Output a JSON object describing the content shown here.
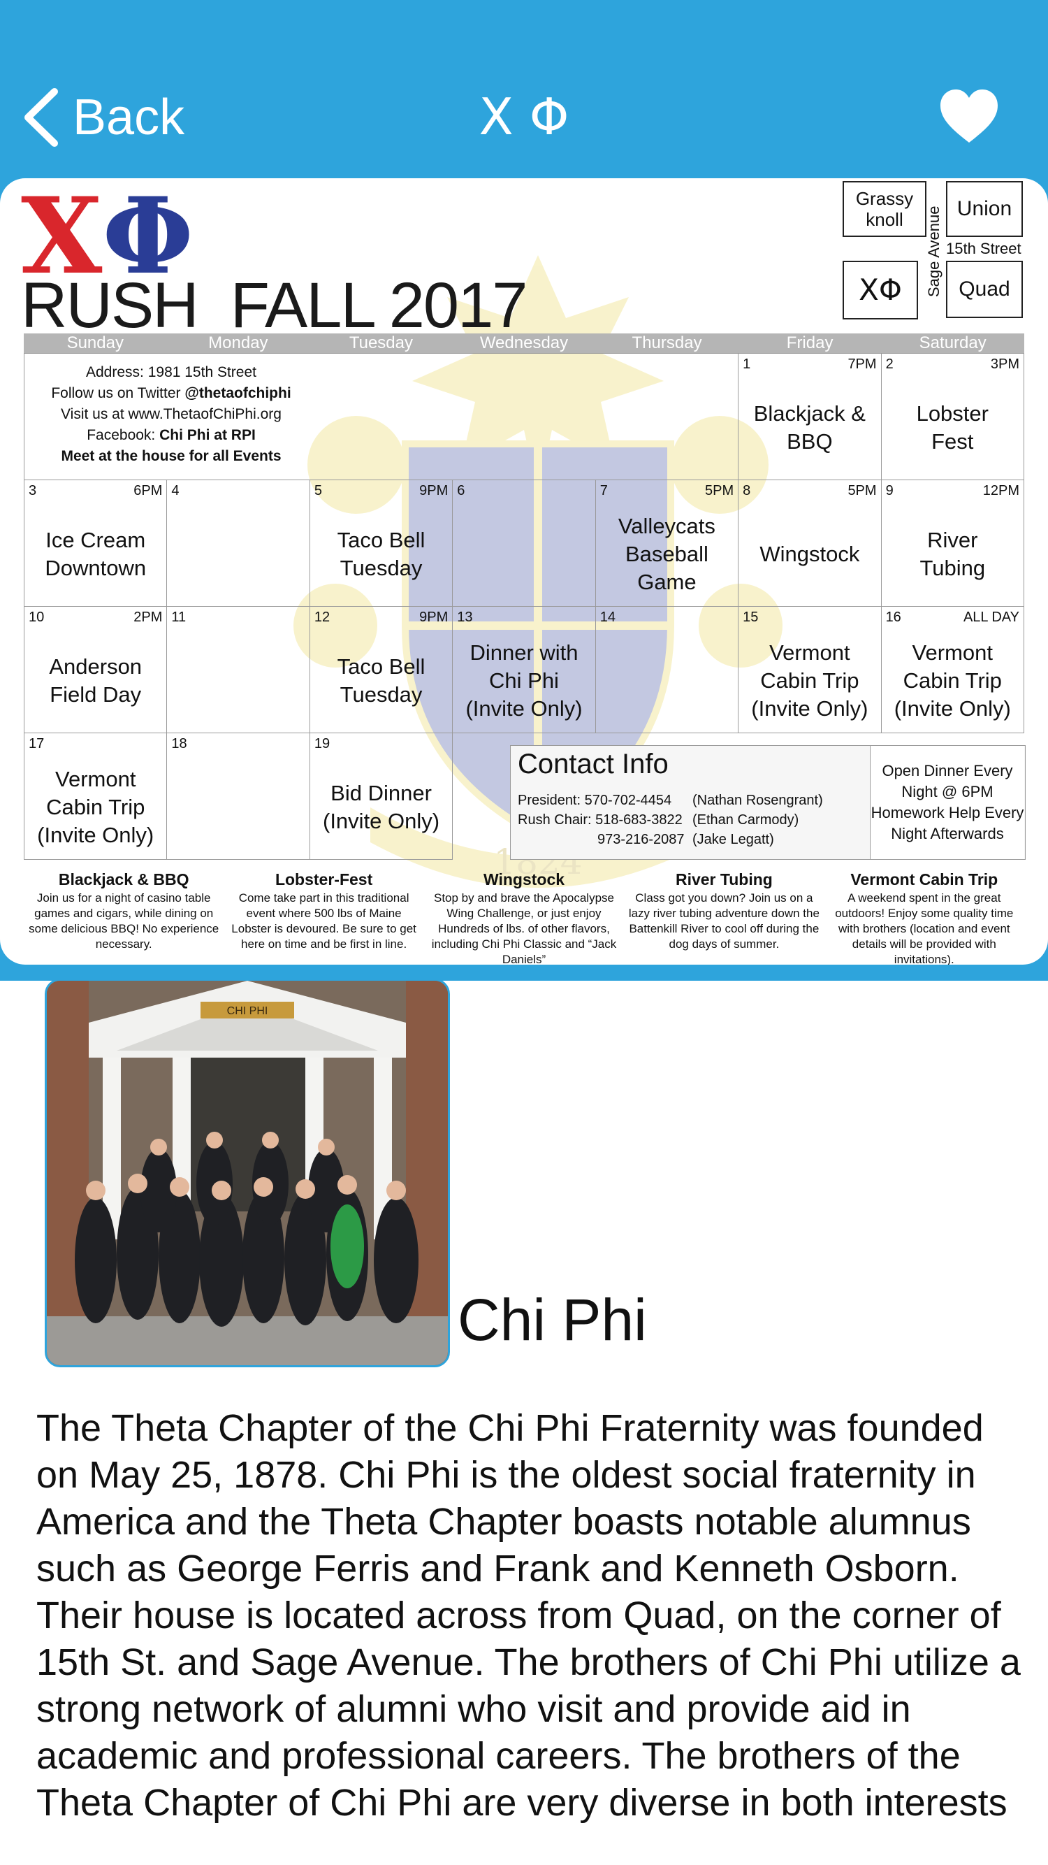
{
  "nav": {
    "back_label": "Back",
    "title": "Χ Φ"
  },
  "flyer": {
    "logo_chi": "Χ",
    "logo_phi": "Φ",
    "title": "RUSH  FALL 2017",
    "map": {
      "grassy_knoll": "Grassy knoll",
      "union": "Union",
      "street_15th": "15th Street",
      "sage_avenue": "Sage Avenue",
      "chi_phi": "ΧΦ",
      "quad": "Quad"
    },
    "days": [
      "Sunday",
      "Monday",
      "Tuesday",
      "Wednesday",
      "Thursday",
      "Friday",
      "Saturday"
    ],
    "info": {
      "address": "Address: 1981 15th Street",
      "twitter_prefix": "Follow us on Twitter ",
      "twitter": "@thetaofchiphi",
      "website": "Visit us at www.ThetaofChiPhi.org",
      "facebook_prefix": "Facebook: ",
      "facebook": "Chi Phi at RPI",
      "meet": "Meet at the house for all Events"
    },
    "cells": [
      {
        "day": "1",
        "time": "7PM",
        "event": "Blackjack &\nBBQ"
      },
      {
        "day": "2",
        "time": "3PM",
        "event": "Lobster\nFest"
      },
      {
        "day": "3",
        "time": "6PM",
        "event": "Ice Cream\nDowntown"
      },
      {
        "day": "4",
        "time": "",
        "event": ""
      },
      {
        "day": "5",
        "time": "9PM",
        "event": "Taco Bell\nTuesday"
      },
      {
        "day": "6",
        "time": "",
        "event": ""
      },
      {
        "day": "7",
        "time": "5PM",
        "event": "Valleycats\nBaseball\nGame"
      },
      {
        "day": "8",
        "time": "5PM",
        "event": "Wingstock"
      },
      {
        "day": "9",
        "time": "12PM",
        "event": "River\nTubing"
      },
      {
        "day": "10",
        "time": "2PM",
        "event": "Anderson\nField Day"
      },
      {
        "day": "11",
        "time": "",
        "event": ""
      },
      {
        "day": "12",
        "time": "9PM",
        "event": "Taco Bell\nTuesday"
      },
      {
        "day": "13",
        "time": "",
        "event": "Dinner with\nChi Phi\n(Invite Only)"
      },
      {
        "day": "14",
        "time": "",
        "event": ""
      },
      {
        "day": "15",
        "time": "",
        "event": "Vermont\nCabin Trip\n(Invite Only)"
      },
      {
        "day": "16",
        "time": "ALL DAY",
        "event": "Vermont\nCabin Trip\n(Invite Only)"
      },
      {
        "day": "17",
        "time": "",
        "event": "Vermont\nCabin Trip\n(Invite Only)"
      },
      {
        "day": "18",
        "time": "",
        "event": ""
      },
      {
        "day": "19",
        "time": "",
        "event": "Bid Dinner\n(Invite Only)"
      }
    ],
    "contact": {
      "title": "Contact Info",
      "president": "President: 570-702-4454",
      "president_name": "(Nathan Rosengrant)",
      "rush_chair": "Rush Chair: 518-683-3822",
      "rush_chair_name": "(Ethan Carmody)",
      "third": "973-216-2087",
      "third_name": "(Jake Legatt)",
      "open_dinner": "Open Dinner Every\nNight @ 6PM\nHomework Help Every\nNight Afterwards"
    },
    "descriptions": [
      {
        "title": "Blackjack & BBQ",
        "text": "Join us for a night of casino table games and cigars, while dining on some delicious BBQ! No experience necessary."
      },
      {
        "title": "Lobster-Fest",
        "text": "Come take part in this traditional event where 500 lbs of Maine Lobster is devoured. Be sure to get here on time and be first in line."
      },
      {
        "title": "Wingstock",
        "text": "Stop by and brave the Apocalypse Wing Challenge, or just enjoy Hundreds of lbs. of other flavors, including Chi Phi Classic and “Jack Daniels”"
      },
      {
        "title": "River Tubing",
        "text": "Class got you down? Join us on a lazy river tubing adventure down the Battenkill River to cool off during the dog days of summer."
      },
      {
        "title": "Vermont Cabin Trip",
        "text": "A weekend spent in the great outdoors! Enjoy some quality time with brothers (location and event details will be provided with invitations)."
      }
    ],
    "crest_banner_text": "1824"
  },
  "photo": {
    "sign_text": "CHI PHI"
  },
  "org_name": "Chi Phi",
  "about": "The Theta Chapter of the Chi Phi Fraternity was founded on May 25, 1878. Chi Phi is the oldest social fraternity in America and the Theta Chapter boasts notable alumnus such as George Ferris and Frank and Kenneth Osborn. Their house is located across from Quad, on the corner of 15th St. and Sage Avenue. The brothers of Chi Phi utilize a strong network of alumni who visit and provide aid in academic and professional careers. The brothers of the Theta Chapter of Chi Phi are very diverse in both interests",
  "colors": {
    "nav_blue": "#2ea4dc",
    "chi_red": "#d9262c",
    "phi_blue": "#2a3d96"
  }
}
